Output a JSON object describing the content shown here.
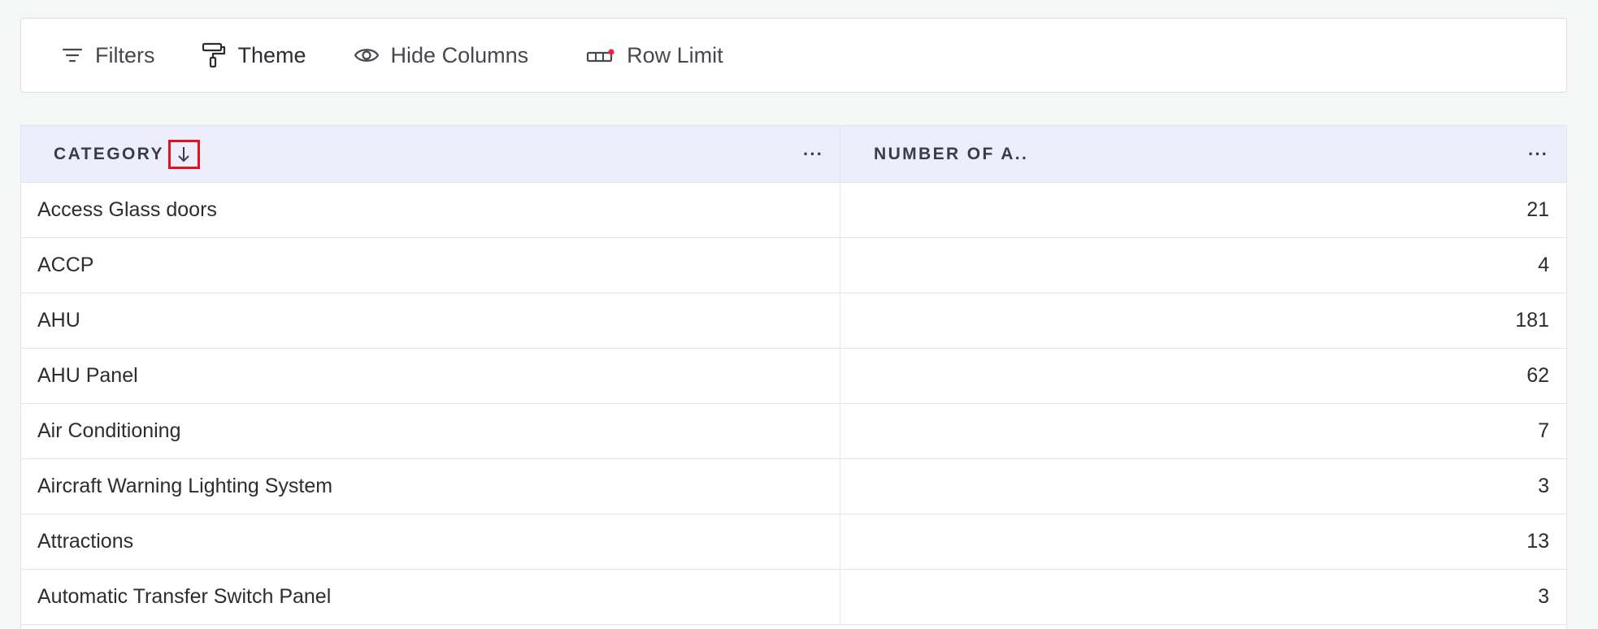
{
  "toolbar": {
    "filters_label": "Filters",
    "theme_label": "Theme",
    "hide_columns_label": "Hide Columns",
    "row_limit_label": "Row Limit"
  },
  "table": {
    "columns": [
      {
        "label": "CATEGORY",
        "sort": "descending",
        "menu": "···"
      },
      {
        "label": "NUMBER OF A..",
        "menu": "···"
      }
    ],
    "rows": [
      {
        "category": "Access Glass doors",
        "count": "21"
      },
      {
        "category": "ACCP",
        "count": "4"
      },
      {
        "category": "AHU",
        "count": "181"
      },
      {
        "category": "AHU Panel",
        "count": "62"
      },
      {
        "category": "Air Conditioning",
        "count": "7"
      },
      {
        "category": "Aircraft Warning Lighting System",
        "count": "3"
      },
      {
        "category": "Attractions",
        "count": "13"
      },
      {
        "category": "Automatic Transfer Switch Panel",
        "count": "3"
      }
    ]
  },
  "colors": {
    "header_bg": "#ededfb",
    "sort_highlight": "#e0131f",
    "row_limit_dot": "#e8263f"
  }
}
